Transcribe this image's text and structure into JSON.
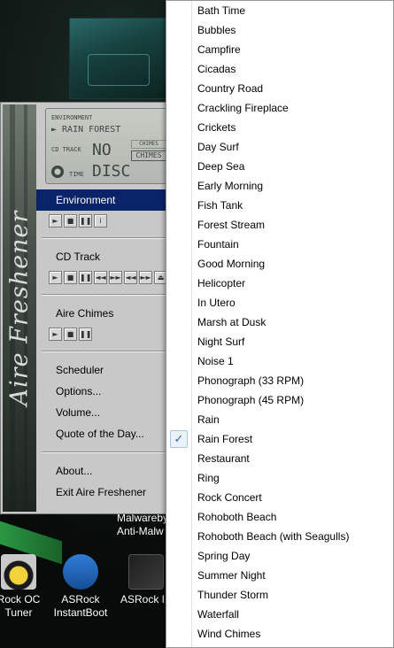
{
  "desktop": {
    "label_lines": [
      "Malwareby",
      "Anti-Malw"
    ],
    "icons": [
      {
        "id": "oc",
        "label": "Rock OC\nTuner"
      },
      {
        "id": "ib",
        "label": "ASRock\nInstantBoot"
      },
      {
        "id": "ies",
        "label": "ASRock IE"
      }
    ]
  },
  "app": {
    "banner_text": "Aire Freshener",
    "lcd": {
      "env_caption": "ENVIRONMENT",
      "env_value": "► RAIN FOREST",
      "cd_caption": "CD TRACK",
      "no_text": "NO",
      "chimes_top": "CHIMES",
      "chimes": "CHIMES",
      "time_caption": "TIME",
      "disc_text": "DISC"
    },
    "menu": {
      "environment": "Environment",
      "cd_track": "CD Track",
      "aire_chimes": "Aire Chimes",
      "scheduler": "Scheduler",
      "options": "Options...",
      "volume": "Volume...",
      "quote": "Quote of the Day...",
      "about": "About...",
      "exit": "Exit Aire Freshener"
    },
    "env_buttons": [
      "►",
      "■",
      "❚❚",
      "i"
    ],
    "cd_buttons": [
      "►",
      "■",
      "❚❚",
      "◄◄",
      "►►",
      "◄◄",
      "►►",
      "⏏"
    ],
    "chime_buttons": [
      "►",
      "■",
      "❚❚"
    ]
  },
  "dropdown": {
    "checked_index": 22,
    "items": [
      "Bath Time",
      "Bubbles",
      "Campfire",
      "Cicadas",
      "Country Road",
      "Crackling Fireplace",
      "Crickets",
      "Day Surf",
      "Deep Sea",
      "Early Morning",
      "Fish Tank",
      "Forest Stream",
      "Fountain",
      "Good Morning",
      "Helicopter",
      "In Utero",
      "Marsh at Dusk",
      "Night Surf",
      "Noise 1",
      "Phonograph (33 RPM)",
      "Phonograph (45 RPM)",
      "Rain",
      "Rain Forest",
      "Restaurant",
      "Ring",
      "Rock Concert",
      "Rohoboth Beach",
      "Rohoboth Beach (with Seagulls)",
      "Spring Day",
      "Summer Night",
      "Thunder Storm",
      "Waterfall",
      "Wind Chimes"
    ]
  }
}
